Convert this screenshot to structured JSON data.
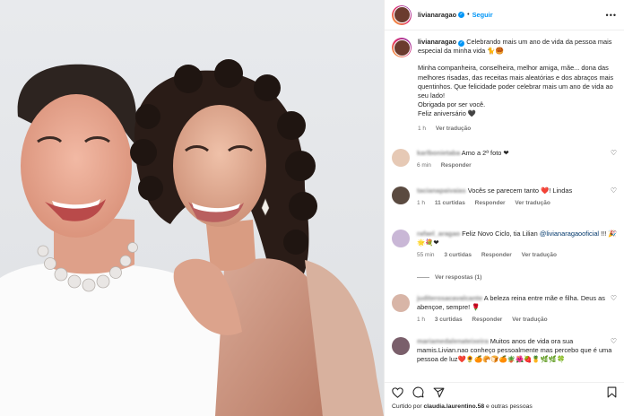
{
  "post": {
    "username": "livianaragao",
    "follow_label": "Seguir",
    "more_icon": "more-options-icon",
    "caption_lines": [
      "Celebrando mais um ano de vida da pessoa mais especial da minha vida 🐈🥮",
      "Minha companheira, conselheira, melhor amiga, mãe... dona das melhores risadas, das receitas mais aleatórias e dos abraços mais quentinhos. Que felicidade poder celebrar mais um ano de vida ao seu lado!",
      "Obrigada por ser você.",
      "Feliz aniversário 🖤"
    ],
    "caption_time": "1 h",
    "caption_translate": "Ver tradução"
  },
  "comments": [
    {
      "user": "karlbonietaba",
      "text": "Amo a 2ª foto ❤",
      "time": "6 min",
      "likes": "",
      "reply": "Responder",
      "translate": ""
    },
    {
      "user": "tacianapaivaias",
      "text": "Vocês se parecem tanto ❤️! Lindas",
      "time": "1 h",
      "likes": "11 curtidas",
      "reply": "Responder",
      "translate": "Ver tradução"
    },
    {
      "user": "rafael_aragao",
      "text": "Feliz Novo Ciclo, tia Lilian @livianaragaooficial !!! 🎉🌟💐❤",
      "mention": "@livianaragaooficial",
      "time": "55 min",
      "likes": "3 curtidas",
      "reply": "Responder",
      "translate": "Ver tradução",
      "view_replies": "Ver respostas (1)"
    },
    {
      "user": "juditerosacavalcante",
      "text": "A beleza reina entre mãe e filha. Deus as abençoe, sempre! 🌹",
      "time": "1 h",
      "likes": "3 curtidas",
      "reply": "Responder",
      "translate": "Ver tradução"
    },
    {
      "user": "mariamedalenateixeira",
      "text": "Muitos anos de vida ora sua mamis.Livian.nao conheço pessoalmente mas percebo que é uma pessoa de luz❤️🌻🍊🥐🍞🍊🪴🌺🍓🍍🌿🌿🍀",
      "time": "",
      "likes": "",
      "reply": "",
      "translate": ""
    }
  ],
  "footer": {
    "liked_prefix": "Curtido por",
    "liked_user": "claudia.laurentino.58",
    "liked_suffix": "e outras pessoas"
  },
  "colors": {
    "accent": "#0095f6",
    "heart_red": "#e0245e"
  }
}
